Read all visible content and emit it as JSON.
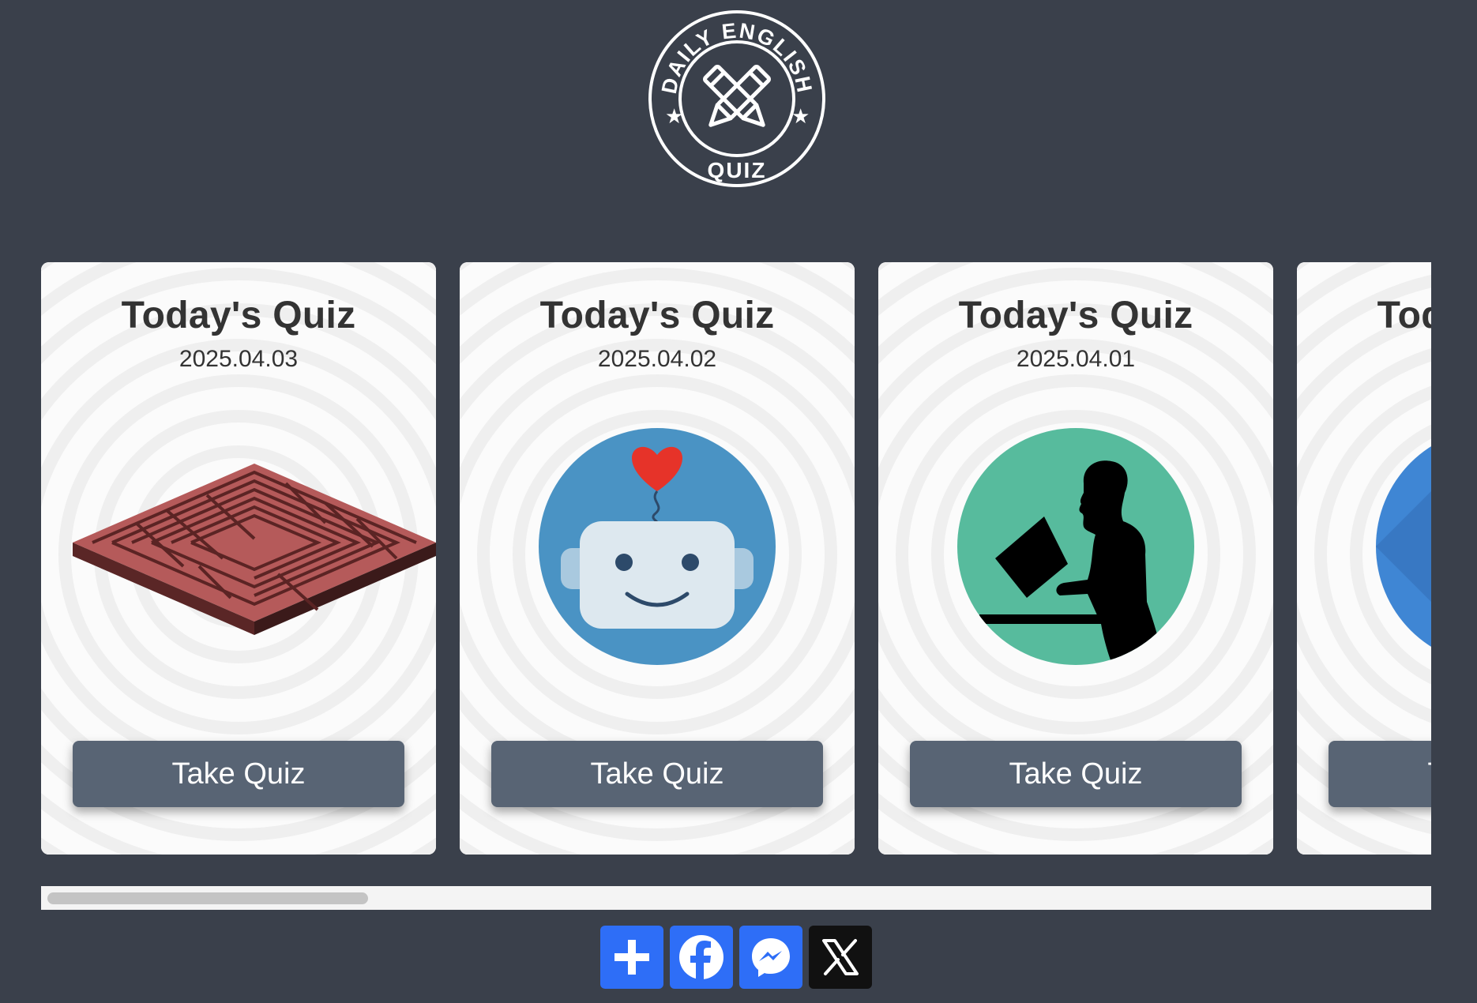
{
  "header": {
    "logo_top_text": "DAILY ENGLISH",
    "logo_bottom_text": "QUIZ",
    "logo_icon": "crossed-pencils-icon"
  },
  "cards": [
    {
      "title": "Today's Quiz",
      "date": "2025.04.03",
      "image": "isometric-maze",
      "button": "Take Quiz"
    },
    {
      "title": "Today's Quiz",
      "date": "2025.04.02",
      "image": "robot-with-heart",
      "button": "Take Quiz"
    },
    {
      "title": "Today's Quiz",
      "date": "2025.04.01",
      "image": "person-reading-silhouette",
      "button": "Take Quiz"
    },
    {
      "title": "Today's Quiz",
      "date": "",
      "image": "blue-circle",
      "button": "Take Quiz"
    }
  ],
  "share": {
    "icons": [
      "add-icon",
      "facebook-icon",
      "messenger-icon",
      "x-icon"
    ]
  },
  "colors": {
    "background": "#3a404b",
    "button": "#586474",
    "share_blue": "#2e6ef7",
    "share_x": "#111111"
  }
}
